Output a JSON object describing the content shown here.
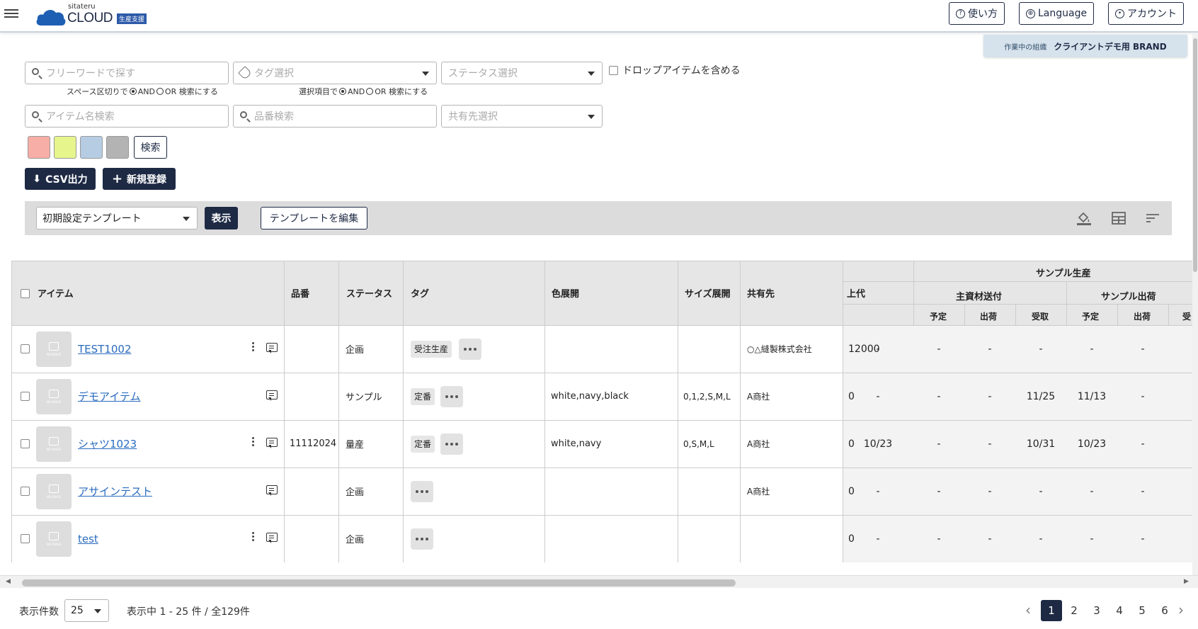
{
  "header": {
    "brand_small": "sitateru",
    "brand_main": "CLOUD",
    "brand_badge": "生産支援",
    "help_label": "使い方",
    "language_label": "Language",
    "account_label": "アカウント"
  },
  "org": {
    "label": "作業中の組織",
    "name": "クライアントデモ用 BRAND"
  },
  "filters": {
    "freeword_placeholder": "フリーワードで探す",
    "tag_placeholder": "タグ選択",
    "status_placeholder": "ステータス選択",
    "include_drop_label": "ドロップアイテムを含める",
    "freeword_hint_pre": "スペース区切りで",
    "tag_hint_pre": "選択項目で",
    "and_label": "AND",
    "or_label": "OR 検索にする",
    "item_name_placeholder": "アイテム名検索",
    "part_no_placeholder": "品番検索",
    "share_placeholder": "共有先選択",
    "search_label": "検索"
  },
  "colors": {
    "swatches": [
      "#f7aea6",
      "#e6f58c",
      "#b6cce3",
      "#b3b3b3"
    ],
    "primary": "#1e2a44",
    "link": "#2a6bbf"
  },
  "actions": {
    "csv_label": "CSV出力",
    "new_label": "新規登録"
  },
  "template": {
    "selected": "初期設定テンプレート",
    "show_label": "表示",
    "edit_label": "テンプレートを編集"
  },
  "table": {
    "headers": {
      "item": "アイテム",
      "part_no": "品番",
      "status": "ステータス",
      "tag": "タグ",
      "colors": "色展開",
      "sizes": "サイズ展開",
      "share": "共有先",
      "price": "上代",
      "sample_production": "サンプル生産",
      "main_material": "主資材送付",
      "sample_shipping": "サンプル出荷",
      "planned": "予定",
      "shipped": "出荷",
      "received": "受取",
      "received_partial": "受"
    },
    "rows": [
      {
        "name": "TEST1002",
        "part_no": "",
        "status": "企画",
        "tag": "受注生産",
        "colors": "",
        "sizes": "",
        "share": "○△縫製株式会社",
        "price": "12000",
        "m_plan": "-",
        "m_ship": "-",
        "m_recv": "-",
        "s_plan": "-",
        "s_ship": "-",
        "s_recv": "-"
      },
      {
        "name": "デモアイテム",
        "part_no": "",
        "status": "サンプル",
        "tag": "定番",
        "colors": "white,navy,black",
        "sizes": "0,1,2,S,M,L",
        "share": "A商社",
        "price": "0",
        "m_plan": "-",
        "m_ship": "-",
        "m_recv": "-",
        "s_plan": "11/25",
        "s_ship": "11/13",
        "s_recv": "-"
      },
      {
        "name": "シャツ1023",
        "part_no": "11112024",
        "status": "量産",
        "tag": "定番",
        "colors": "white,navy",
        "sizes": "0,S,M,L",
        "share": "A商社",
        "price": "0",
        "m_plan": "10/23",
        "m_ship": "-",
        "m_recv": "-",
        "s_plan": "10/31",
        "s_ship": "10/23",
        "s_recv": "-"
      },
      {
        "name": "アサインテスト",
        "part_no": "",
        "status": "企画",
        "tag": "",
        "colors": "",
        "sizes": "",
        "share": "A商社",
        "price": "0",
        "m_plan": "-",
        "m_ship": "-",
        "m_recv": "-",
        "s_plan": "-",
        "s_ship": "-",
        "s_recv": "-"
      },
      {
        "name": "test",
        "part_no": "",
        "status": "企画",
        "tag": "",
        "colors": "",
        "sizes": "",
        "share": "",
        "price": "0",
        "m_plan": "-",
        "m_ship": "-",
        "m_recv": "-",
        "s_plan": "-",
        "s_ship": "-",
        "s_recv": "-"
      }
    ]
  },
  "footer": {
    "per_page_label": "表示件数",
    "per_page_value": "25",
    "range_text": "表示中 1 - 25 件 / 全129件",
    "pages": [
      "1",
      "2",
      "3",
      "4",
      "5",
      "6"
    ]
  }
}
